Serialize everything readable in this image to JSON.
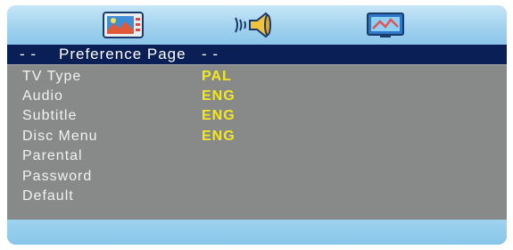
{
  "top_icons": [
    {
      "name": "tv-picture-icon"
    },
    {
      "name": "speaker-audio-icon"
    },
    {
      "name": "monitor-settings-icon"
    }
  ],
  "header": {
    "dashes_left": "- -",
    "title": "Preference Page",
    "dashes_right": "- -"
  },
  "menu": {
    "items": [
      {
        "label": "TV Type",
        "value": "PAL"
      },
      {
        "label": "Audio",
        "value": "ENG"
      },
      {
        "label": "Subtitle",
        "value": "ENG"
      },
      {
        "label": "Disc Menu",
        "value": "ENG"
      },
      {
        "label": "Parental",
        "value": ""
      },
      {
        "label": "Password",
        "value": ""
      },
      {
        "label": "Default",
        "value": ""
      }
    ]
  },
  "colors": {
    "header_bg": "#0a1f55",
    "panel_bg": "#888a89",
    "value_text": "#f4e81b",
    "label_text": "#f2f2f2",
    "bar_blue": "#9fd1ee"
  }
}
